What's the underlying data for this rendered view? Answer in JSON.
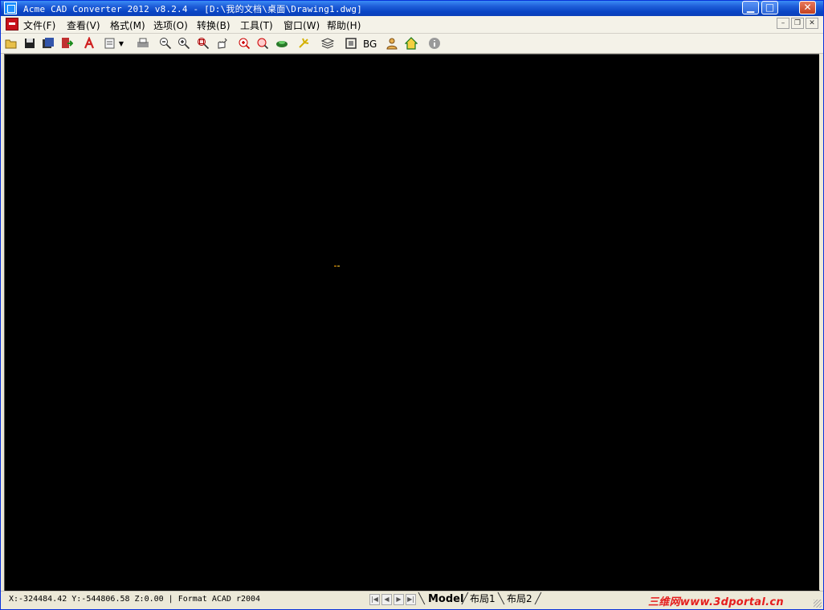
{
  "window": {
    "title": "Acme CAD Converter 2012 v8.2.4 - [D:\\我的文档\\桌面\\Drawing1.dwg]"
  },
  "title_buttons": {
    "minimize": "▁",
    "maximize": "□",
    "close": "✕"
  },
  "menu": {
    "items": [
      "文件(F)",
      "查看(V)",
      "格式(M)",
      "选项(O)",
      "转换(B)",
      "工具(T)",
      "窗口(W)",
      "帮助(H)"
    ],
    "mdi_buttons": {
      "minimize": "–",
      "restore": "❐",
      "close": "✕"
    }
  },
  "toolbar": {
    "bg_label": "BG",
    "icons": [
      "open-icon",
      "save-icon",
      "save-all-icon",
      "export-icon",
      "pdf-icon",
      "batch-icon",
      "print-icon",
      "zoom-out-icon",
      "zoom-in-icon",
      "zoom-window-icon",
      "pan-icon",
      "zoom-realtime-icon",
      "zoom-extents-icon",
      "layer-icon",
      "light-icon",
      "layers-icon",
      "frame-icon",
      "bg-toggle",
      "user-icon",
      "home-icon",
      "info-icon"
    ]
  },
  "status": {
    "coords": "X:-324484.42 Y:-544806.58 Z:0.00 | Format ACAD r2004",
    "tabs": [
      "Model",
      "布局1",
      "布局2"
    ],
    "active_tab": "Model",
    "watermark_cn": "三维网",
    "watermark_url": "www.3dportal.cn"
  },
  "colors": {
    "canvas_bg": "#000000",
    "titlebar": "#0a46c6",
    "crosshair": "#ffa500",
    "watermark": "#e51d1d"
  }
}
